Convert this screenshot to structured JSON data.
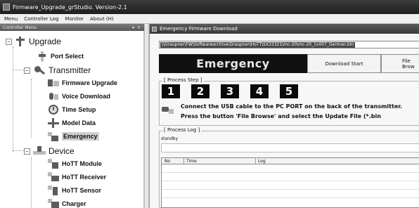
{
  "window": {
    "title": "Firmware_Upgrade_grStudio.  Version-2.1"
  },
  "menu": {
    "items": [
      "Menu",
      "Controller Log",
      "Monitor",
      "About (H)"
    ]
  },
  "left_panel": {
    "header": "Controller Menu",
    "header_buttons": "▾ ×",
    "tree": {
      "upgrade": "Upgrade",
      "port_select": "Port Select",
      "transmitter": "Transmitter",
      "firmware_upgrade": "Firmware Upgrade",
      "voice_download": "Voice Download",
      "time_setup": "Time Setup",
      "model_data": "Model Data",
      "emergency": "Emergency",
      "device": "Device",
      "hott_module": "HoTT Module",
      "hott_receiver": "HoTT Receiver",
      "hott_sensor": "HoTT Sensor",
      "charger": "Charger"
    },
    "expander_minus": "−"
  },
  "main": {
    "header": "Emergency Firmware Download",
    "path": "\\\\Graupner\\FW\\Softwarearchive\\Graupner\\HoTT\\SX33321\\mc-20\\mc-20_1v007_German.bin",
    "mode": "Emergency",
    "download_start": "Download Start",
    "file_browse": "File Brow",
    "process_step_label": "[ Process Step ]",
    "steps": [
      "1",
      "2",
      "3",
      "4",
      "5"
    ],
    "instruction_1": "Connect the USB cable to the PC PORT on the back of the transmitter.",
    "instruction_2": "Press the button 'File Browse' and select the Update File (*.bin",
    "process_log_label": "[ Process Log ]",
    "status": "standby",
    "table_headers": {
      "no": "No",
      "time": "Time",
      "log": "Log"
    }
  }
}
